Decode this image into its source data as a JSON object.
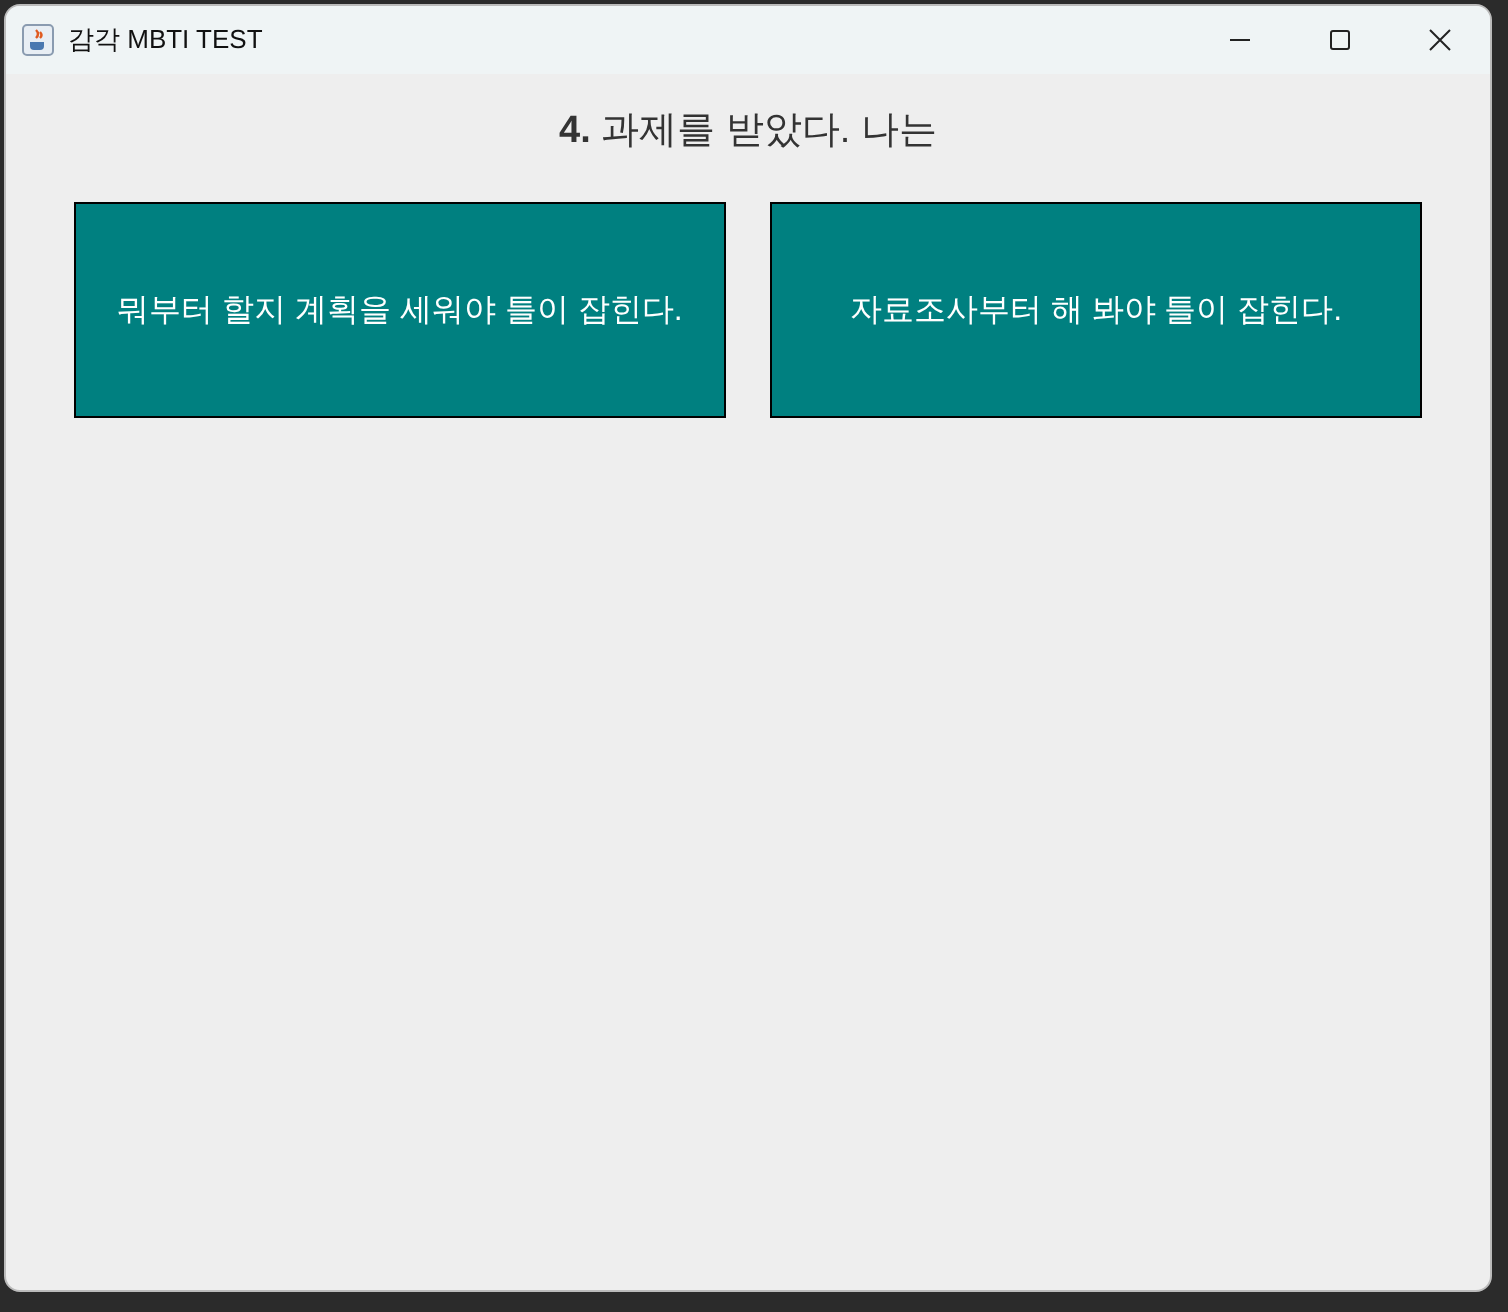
{
  "window": {
    "title": "감각 MBTI TEST"
  },
  "question": "**4.** 과제를 받았다. 나는",
  "answers": [
    {
      "label": "뭐부터 할지 계획을 세워야 틀이 잡힌다."
    },
    {
      "label": "자료조사부터 해 봐야 틀이 잡힌다."
    }
  ]
}
